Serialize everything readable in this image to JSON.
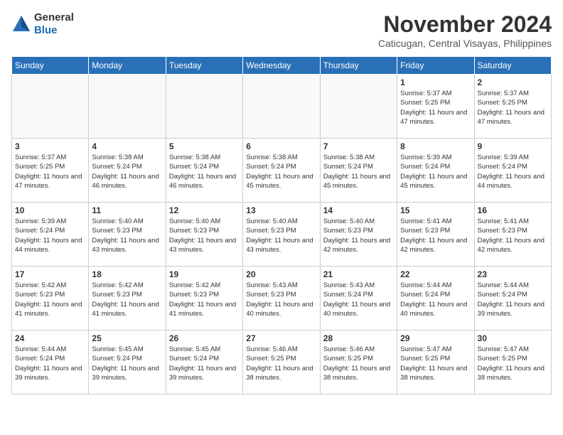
{
  "header": {
    "logo_general": "General",
    "logo_blue": "Blue",
    "month_title": "November 2024",
    "location": "Caticugan, Central Visayas, Philippines"
  },
  "weekdays": [
    "Sunday",
    "Monday",
    "Tuesday",
    "Wednesday",
    "Thursday",
    "Friday",
    "Saturday"
  ],
  "weeks": [
    [
      {
        "day": "",
        "info": "",
        "empty": true
      },
      {
        "day": "",
        "info": "",
        "empty": true
      },
      {
        "day": "",
        "info": "",
        "empty": true
      },
      {
        "day": "",
        "info": "",
        "empty": true
      },
      {
        "day": "",
        "info": "",
        "empty": true
      },
      {
        "day": "1",
        "info": "Sunrise: 5:37 AM\nSunset: 5:25 PM\nDaylight: 11 hours and 47 minutes.",
        "empty": false
      },
      {
        "day": "2",
        "info": "Sunrise: 5:37 AM\nSunset: 5:25 PM\nDaylight: 11 hours and 47 minutes.",
        "empty": false
      }
    ],
    [
      {
        "day": "3",
        "info": "Sunrise: 5:37 AM\nSunset: 5:25 PM\nDaylight: 11 hours and 47 minutes.",
        "empty": false
      },
      {
        "day": "4",
        "info": "Sunrise: 5:38 AM\nSunset: 5:24 PM\nDaylight: 11 hours and 46 minutes.",
        "empty": false
      },
      {
        "day": "5",
        "info": "Sunrise: 5:38 AM\nSunset: 5:24 PM\nDaylight: 11 hours and 46 minutes.",
        "empty": false
      },
      {
        "day": "6",
        "info": "Sunrise: 5:38 AM\nSunset: 5:24 PM\nDaylight: 11 hours and 45 minutes.",
        "empty": false
      },
      {
        "day": "7",
        "info": "Sunrise: 5:38 AM\nSunset: 5:24 PM\nDaylight: 11 hours and 45 minutes.",
        "empty": false
      },
      {
        "day": "8",
        "info": "Sunrise: 5:39 AM\nSunset: 5:24 PM\nDaylight: 11 hours and 45 minutes.",
        "empty": false
      },
      {
        "day": "9",
        "info": "Sunrise: 5:39 AM\nSunset: 5:24 PM\nDaylight: 11 hours and 44 minutes.",
        "empty": false
      }
    ],
    [
      {
        "day": "10",
        "info": "Sunrise: 5:39 AM\nSunset: 5:24 PM\nDaylight: 11 hours and 44 minutes.",
        "empty": false
      },
      {
        "day": "11",
        "info": "Sunrise: 5:40 AM\nSunset: 5:23 PM\nDaylight: 11 hours and 43 minutes.",
        "empty": false
      },
      {
        "day": "12",
        "info": "Sunrise: 5:40 AM\nSunset: 5:23 PM\nDaylight: 11 hours and 43 minutes.",
        "empty": false
      },
      {
        "day": "13",
        "info": "Sunrise: 5:40 AM\nSunset: 5:23 PM\nDaylight: 11 hours and 43 minutes.",
        "empty": false
      },
      {
        "day": "14",
        "info": "Sunrise: 5:40 AM\nSunset: 5:23 PM\nDaylight: 11 hours and 42 minutes.",
        "empty": false
      },
      {
        "day": "15",
        "info": "Sunrise: 5:41 AM\nSunset: 5:23 PM\nDaylight: 11 hours and 42 minutes.",
        "empty": false
      },
      {
        "day": "16",
        "info": "Sunrise: 5:41 AM\nSunset: 5:23 PM\nDaylight: 11 hours and 42 minutes.",
        "empty": false
      }
    ],
    [
      {
        "day": "17",
        "info": "Sunrise: 5:42 AM\nSunset: 5:23 PM\nDaylight: 11 hours and 41 minutes.",
        "empty": false
      },
      {
        "day": "18",
        "info": "Sunrise: 5:42 AM\nSunset: 5:23 PM\nDaylight: 11 hours and 41 minutes.",
        "empty": false
      },
      {
        "day": "19",
        "info": "Sunrise: 5:42 AM\nSunset: 5:23 PM\nDaylight: 11 hours and 41 minutes.",
        "empty": false
      },
      {
        "day": "20",
        "info": "Sunrise: 5:43 AM\nSunset: 5:23 PM\nDaylight: 11 hours and 40 minutes.",
        "empty": false
      },
      {
        "day": "21",
        "info": "Sunrise: 5:43 AM\nSunset: 5:24 PM\nDaylight: 11 hours and 40 minutes.",
        "empty": false
      },
      {
        "day": "22",
        "info": "Sunrise: 5:44 AM\nSunset: 5:24 PM\nDaylight: 11 hours and 40 minutes.",
        "empty": false
      },
      {
        "day": "23",
        "info": "Sunrise: 5:44 AM\nSunset: 5:24 PM\nDaylight: 11 hours and 39 minutes.",
        "empty": false
      }
    ],
    [
      {
        "day": "24",
        "info": "Sunrise: 5:44 AM\nSunset: 5:24 PM\nDaylight: 11 hours and 39 minutes.",
        "empty": false
      },
      {
        "day": "25",
        "info": "Sunrise: 5:45 AM\nSunset: 5:24 PM\nDaylight: 11 hours and 39 minutes.",
        "empty": false
      },
      {
        "day": "26",
        "info": "Sunrise: 5:45 AM\nSunset: 5:24 PM\nDaylight: 11 hours and 39 minutes.",
        "empty": false
      },
      {
        "day": "27",
        "info": "Sunrise: 5:46 AM\nSunset: 5:25 PM\nDaylight: 11 hours and 38 minutes.",
        "empty": false
      },
      {
        "day": "28",
        "info": "Sunrise: 5:46 AM\nSunset: 5:25 PM\nDaylight: 11 hours and 38 minutes.",
        "empty": false
      },
      {
        "day": "29",
        "info": "Sunrise: 5:47 AM\nSunset: 5:25 PM\nDaylight: 11 hours and 38 minutes.",
        "empty": false
      },
      {
        "day": "30",
        "info": "Sunrise: 5:47 AM\nSunset: 5:25 PM\nDaylight: 11 hours and 38 minutes.",
        "empty": false
      }
    ]
  ]
}
